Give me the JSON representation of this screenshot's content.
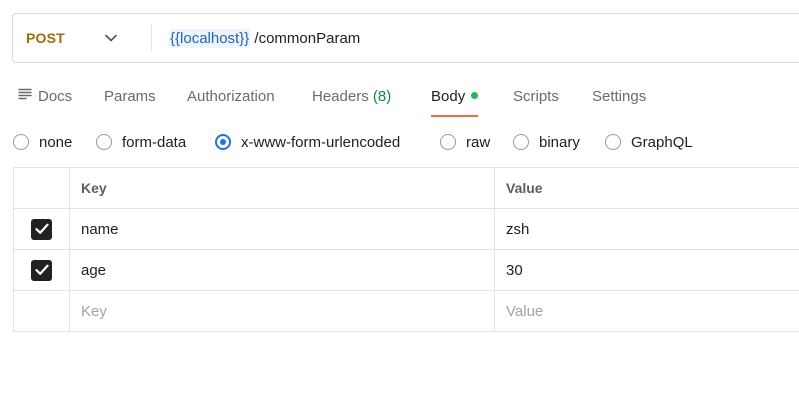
{
  "request": {
    "method": "POST",
    "url_variable": "{{localhost}}",
    "url_path": "/commonParam"
  },
  "tabs": [
    {
      "label": "Docs"
    },
    {
      "label": "Params"
    },
    {
      "label": "Authorization"
    },
    {
      "label": "Headers",
      "count": "(8)"
    },
    {
      "label": "Body",
      "active": true
    },
    {
      "label": "Scripts"
    },
    {
      "label": "Settings"
    }
  ],
  "body_types": [
    {
      "label": "none",
      "selected": false
    },
    {
      "label": "form-data",
      "selected": false
    },
    {
      "label": "x-www-form-urlencoded",
      "selected": true
    },
    {
      "label": "raw",
      "selected": false
    },
    {
      "label": "binary",
      "selected": false
    },
    {
      "label": "GraphQL",
      "selected": false
    }
  ],
  "table": {
    "headers": {
      "key": "Key",
      "value": "Value"
    },
    "rows": [
      {
        "checked": true,
        "key": "name",
        "value": "zsh"
      },
      {
        "checked": true,
        "key": "age",
        "value": "30"
      }
    ],
    "placeholder": {
      "key": "Key",
      "value": "Value"
    }
  },
  "colors": {
    "method": "#a56a00",
    "url_variable": "#1f64c8",
    "active_tab_underline": "#f26b3a",
    "body_dot": "#1db954",
    "headers_count": "#0e8a3a",
    "radio_selected": "#1a73e8"
  }
}
